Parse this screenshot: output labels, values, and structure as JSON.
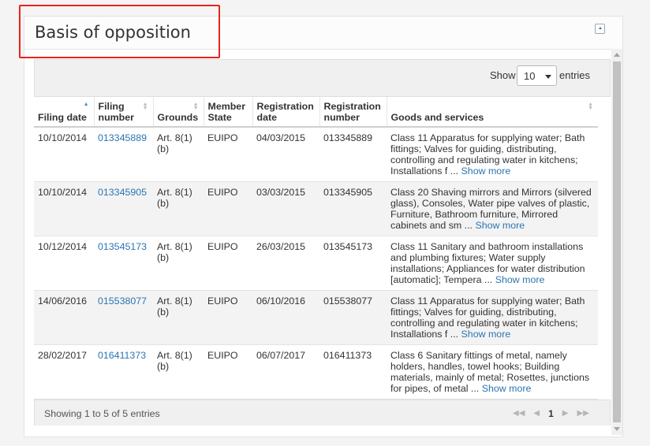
{
  "panel": {
    "title": "Basis of opposition",
    "highlight_color": "#e8231f"
  },
  "toolbar": {
    "show_label": "Show",
    "entries_value": "10",
    "entries_label": "entries"
  },
  "table": {
    "columns": [
      {
        "line1": "Filing date",
        "line2": ""
      },
      {
        "line1": "Filing",
        "line2": "number"
      },
      {
        "line1": "Grounds",
        "line2": ""
      },
      {
        "line1": "Member",
        "line2": "State"
      },
      {
        "line1": "Registration",
        "line2": "date"
      },
      {
        "line1": "Registration",
        "line2": "number"
      },
      {
        "line1": "Goods and services",
        "line2": ""
      }
    ],
    "rows": [
      {
        "filing_date": "10/10/2014",
        "filing_number": "013345889",
        "grounds": "Art. 8(1) (b)",
        "member_state": "EUIPO",
        "registration_date": "04/03/2015",
        "registration_number": "013345889",
        "goods": "Class 11 Apparatus for supplying water; Bath fittings; Valves for guiding, distributing, controlling and regulating water in kitchens; Installations f ...",
        "show_more": "Show more"
      },
      {
        "filing_date": "10/10/2014",
        "filing_number": "013345905",
        "grounds": "Art. 8(1) (b)",
        "member_state": "EUIPO",
        "registration_date": "03/03/2015",
        "registration_number": "013345905",
        "goods": "Class 20 Shaving mirrors and Mirrors (silvered glass), Consoles, Water pipe valves of plastic, Furniture, Bathroom furniture, Mirrored cabinets and sm ...",
        "show_more": "Show more"
      },
      {
        "filing_date": "10/12/2014",
        "filing_number": "013545173",
        "grounds": "Art. 8(1) (b)",
        "member_state": "EUIPO",
        "registration_date": "26/03/2015",
        "registration_number": "013545173",
        "goods": "Class 11 Sanitary and bathroom installations and plumbing fixtures; Water supply installations; Appliances for water distribution [automatic]; Tempera ...",
        "show_more": "Show more"
      },
      {
        "filing_date": "14/06/2016",
        "filing_number": "015538077",
        "grounds": "Art. 8(1) (b)",
        "member_state": "EUIPO",
        "registration_date": "06/10/2016",
        "registration_number": "015538077",
        "goods": "Class 11 Apparatus for supplying water; Bath fittings; Valves for guiding, distributing, controlling and regulating water in kitchens; Installations f ...",
        "show_more": "Show more"
      },
      {
        "filing_date": "28/02/2017",
        "filing_number": "016411373",
        "grounds": "Art. 8(1) (b)",
        "member_state": "EUIPO",
        "registration_date": "06/07/2017",
        "registration_number": "016411373",
        "goods": "Class 6 Sanitary fittings of metal, namely holders, handles, towel hooks; Building materials, mainly of metal; Rosettes, junctions for pipes, of metal ...",
        "show_more": "Show more"
      }
    ]
  },
  "footer": {
    "info": "Showing 1 to 5 of 5 entries",
    "current_page": "1"
  },
  "icons": {
    "first": "first-page-icon",
    "prev": "prev-page-icon",
    "next": "next-page-icon",
    "last": "last-page-icon",
    "sort": "sort-icon",
    "collapse": "collapse-icon"
  },
  "colors": {
    "link": "#2a75b3",
    "stripe": "#f3f3f3"
  }
}
